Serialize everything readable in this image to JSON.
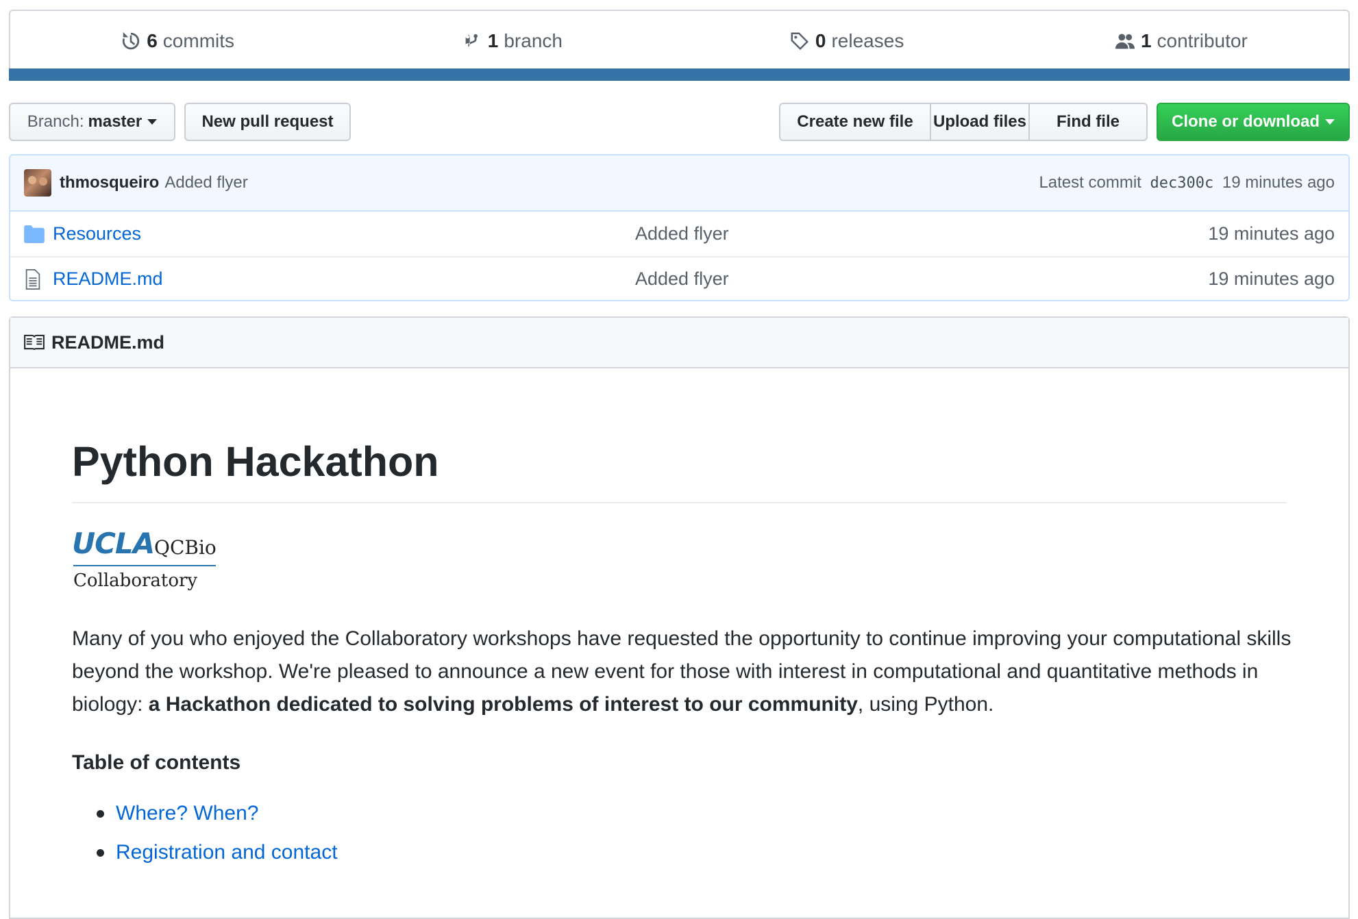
{
  "stats": {
    "commits": {
      "count": "6",
      "label": "commits",
      "icon": "history-icon"
    },
    "branches": {
      "count": "1",
      "label": "branch",
      "icon": "git-branch-icon"
    },
    "releases": {
      "count": "0",
      "label": "releases",
      "icon": "tag-icon"
    },
    "contributors": {
      "count": "1",
      "label": "contributor",
      "icon": "people-icon"
    },
    "language_color": "#3572A5"
  },
  "toolbar": {
    "branch_prefix": "Branch:",
    "branch_name": "master",
    "new_pull_request": "New pull request",
    "create_new_file": "Create new file",
    "upload_files": "Upload files",
    "find_file": "Find file",
    "clone_or_download": "Clone or download",
    "clone_color": "#28a745"
  },
  "latest_commit": {
    "author": "thmosqueiro",
    "message": "Added flyer",
    "prefix": "Latest commit",
    "sha": "dec300c",
    "age": "19 minutes ago"
  },
  "files": [
    {
      "name": "Resources",
      "type": "folder",
      "icon": "folder-icon",
      "message": "Added flyer",
      "age": "19 minutes ago"
    },
    {
      "name": "README.md",
      "type": "file",
      "icon": "file-icon",
      "message": "Added flyer",
      "age": "19 minutes ago"
    }
  ],
  "readme": {
    "header": "README.md",
    "title": "Python Hackathon",
    "logo": {
      "ucla": "UCLA",
      "qcbio": "QCBio",
      "collaboratory": "Collaboratory"
    },
    "intro_plain": "Many of you who enjoyed the Collaboratory workshops have requested the opportunity to continue improving your computational skills beyond the workshop. We're pleased to announce a new event for those with interest in computational and quantitative methods in biology: ",
    "intro_bold": "a Hackathon dedicated to solving problems of interest to our community",
    "intro_end": ", using Python.",
    "toc_title": "Table of contents",
    "toc": [
      "Where? When?",
      "Registration and contact"
    ]
  }
}
